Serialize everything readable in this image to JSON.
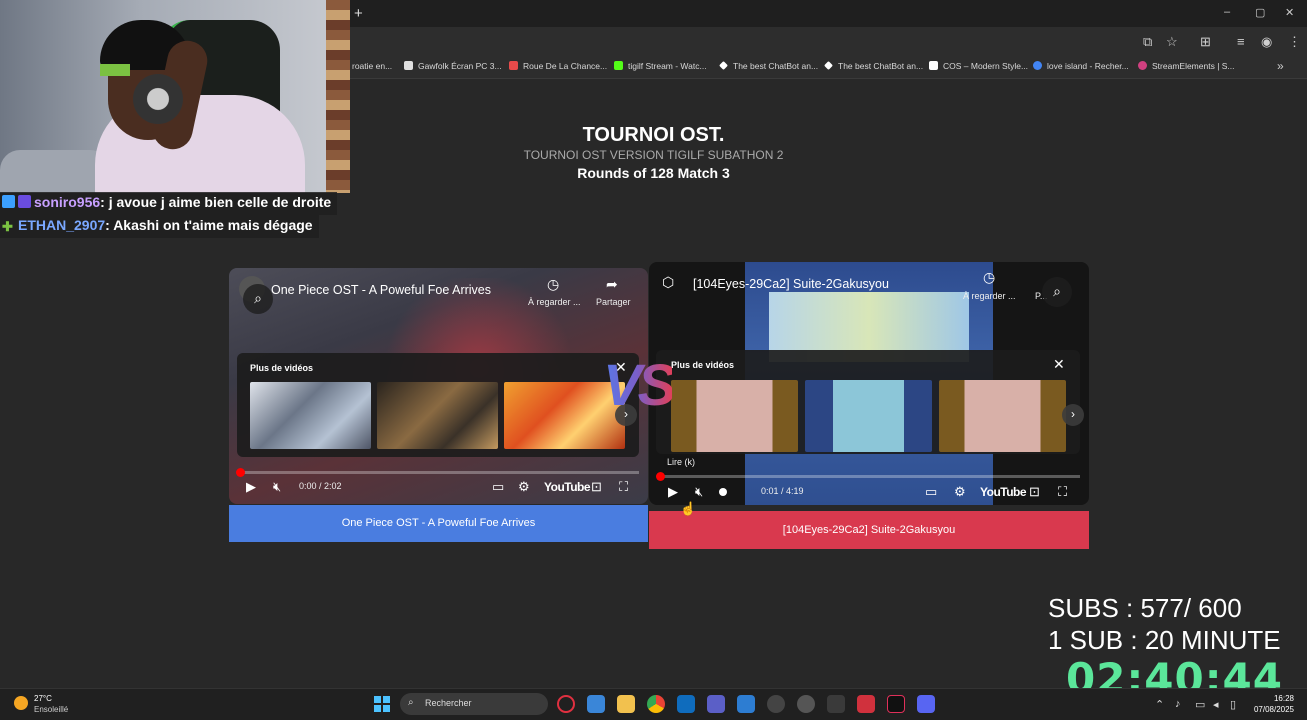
{
  "browser": {
    "new_tab_symbol": "+",
    "window_controls": [
      "–",
      "▢",
      "✕"
    ],
    "bookmarks": [
      {
        "label": "roatie en...",
        "color": "#8a5aa8"
      },
      {
        "label": "Gawfolk Écran PC 3...",
        "color": "#e0e0e0"
      },
      {
        "label": "Roue De La Chance...",
        "color": "#e84a4a"
      },
      {
        "label": "tigilf Stream - Watc...",
        "color": "#53fc18"
      },
      {
        "label": "The best ChatBot an...",
        "color": "#ffffff"
      },
      {
        "label": "The best ChatBot an...",
        "color": "#ffffff"
      },
      {
        "label": "COS – Modern Style...",
        "color": "#ffffff"
      },
      {
        "label": "love island - Recher...",
        "color": "#4285f4"
      },
      {
        "label": "StreamElements | S...",
        "color": "#d04080"
      }
    ],
    "more_symbol": "»"
  },
  "chat": [
    {
      "user": "soniro956",
      "message": ": j avoue j aime bien celle de droite",
      "user_color": "#c8a0ff"
    },
    {
      "user": "ETHAN_2907",
      "message": ": Akashi on t'aime mais dégage",
      "user_color": "#7aa8ff"
    }
  ],
  "header": {
    "title": "TOURNOI OST.",
    "subtitle": "TOURNOI OST VERSION TIGILF SUBATHON 2",
    "round": "Rounds of 128 Match 3"
  },
  "player_left": {
    "title": "One Piece OST - A Poweful Foe Arrives",
    "watch_later": "À regarder ...",
    "share": "Partager",
    "more_videos": "Plus de vidéos",
    "time": "0:00 / 2:02",
    "brand": "YouTube",
    "progress": 0.0
  },
  "player_right": {
    "title": "[104Eyes-29Ca2] Suite-2Gakusyou",
    "watch_later": "À regarder ...",
    "share_short": "P...",
    "more_videos": "Plus de vidéos",
    "play_hint": "Lire (k)",
    "time": "0:01 / 4:19",
    "brand": "YouTube",
    "progress": 0.004
  },
  "vs_text": "VS",
  "votes": {
    "left": "One Piece OST - A Poweful Foe Arrives",
    "right": "[104Eyes-29Ca2] Suite-2Gakusyou"
  },
  "overlay": {
    "subs": "SUBS : 577/ 600",
    "rate": "1 SUB :  20 MINUTE",
    "timer": "02:40:44"
  },
  "taskbar": {
    "temperature": "27°C",
    "condition": "Ensoleillé",
    "search_placeholder": "Rechercher",
    "time": "16:28",
    "date": "07/08/2025"
  },
  "colors": {
    "accent_blue": "#4a7de0",
    "accent_red": "#d9394e",
    "timer_green": "#5be69a"
  }
}
